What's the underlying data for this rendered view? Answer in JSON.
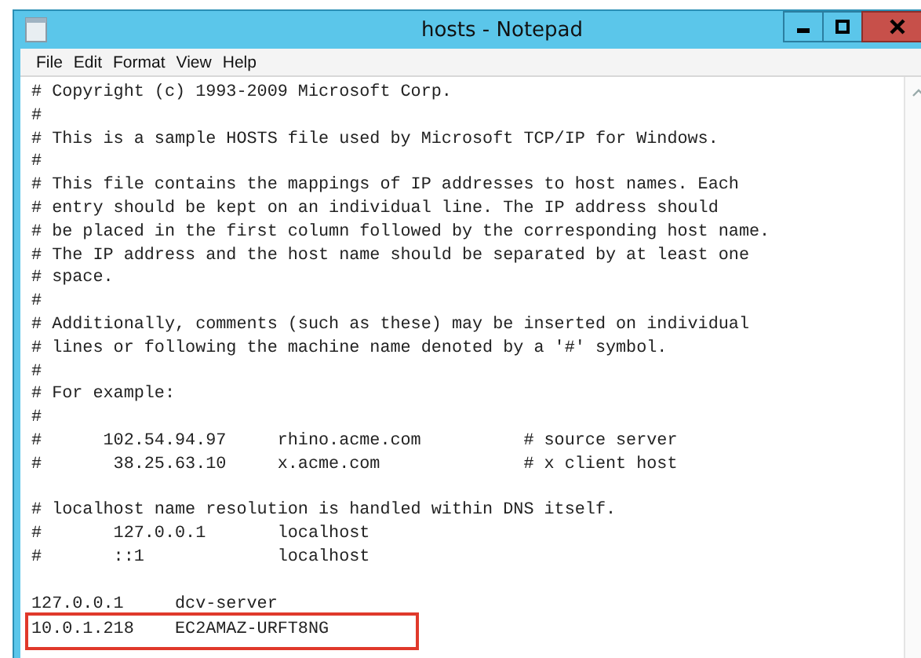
{
  "window": {
    "title": "hosts - Notepad"
  },
  "menu": [
    "File",
    "Edit",
    "Format",
    "View",
    "Help"
  ],
  "blocks": [
    {
      "lines": [
        {
          "text": "# Copyright (c) 1993-2009 Microsoft Corp.",
          "highlighted": false
        },
        {
          "text": "#",
          "highlighted": false
        },
        {
          "text": "# This is a sample HOSTS file used by Microsoft TCP/IP for Windows.",
          "highlighted": false
        },
        {
          "text": "#",
          "highlighted": false
        },
        {
          "text": "# This file contains the mappings of IP addresses to host names. Each",
          "highlighted": false
        },
        {
          "text": "# entry should be kept on an individual line. The IP address should",
          "highlighted": false
        },
        {
          "text": "# be placed in the first column followed by the corresponding host name.",
          "highlighted": false
        },
        {
          "text": "# The IP address and the host name should be separated by at least one",
          "highlighted": false
        },
        {
          "text": "# space.",
          "highlighted": false
        },
        {
          "text": "#",
          "highlighted": false
        },
        {
          "text": "# Additionally, comments (such as these) may be inserted on individual",
          "highlighted": false
        },
        {
          "text": "# lines or following the machine name denoted by a '#' symbol.",
          "highlighted": false
        },
        {
          "text": "#",
          "highlighted": false
        },
        {
          "text": "# For example:",
          "highlighted": false
        },
        {
          "text": "#",
          "highlighted": false
        },
        {
          "text": "#      102.54.94.97     rhino.acme.com          # source server",
          "highlighted": false
        },
        {
          "text": "#       38.25.63.10     x.acme.com              # x client host",
          "highlighted": false
        }
      ]
    },
    {
      "lines": [
        {
          "text": "# localhost name resolution is handled within DNS itself.",
          "highlighted": false
        },
        {
          "text": "#       127.0.0.1       localhost",
          "highlighted": false
        },
        {
          "text": "#       ::1             localhost",
          "highlighted": false
        }
      ]
    },
    {
      "lines": [
        {
          "text": "127.0.0.1     dcv-server",
          "highlighted": false
        },
        {
          "text": "10.0.1.218    EC2AMAZ-URFT8NG",
          "highlighted": true
        }
      ]
    }
  ]
}
